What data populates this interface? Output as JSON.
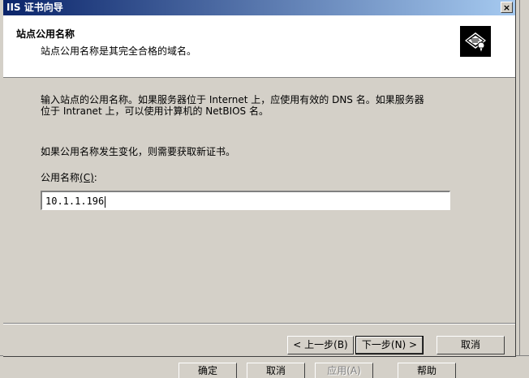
{
  "dialog": {
    "title": "IIS 证书向导",
    "close_label": "×",
    "header": {
      "title": "站点公用名称",
      "subtitle": "站点公用名称是其完全合格的域名。",
      "icon": "certificate-wizard-icon"
    },
    "description_line1": "输入站点的公用名称。如果服务器位于 Internet 上，应使用有效的 DNS 名。如果服务器",
    "description_line2": "位于 Intranet 上，可以使用计算机的 NetBIOS 名。",
    "change_note": "如果公用名称发生变化，则需要获取新证书。",
    "field_label": "公用名称",
    "field_accel": "(C)",
    "field_colon": ":",
    "common_name_value": "10.1.1.196",
    "buttons": {
      "back": "< 上一步(B)",
      "next": "下一步(N) >",
      "cancel": "取消"
    }
  },
  "parent_window": {
    "buttons": {
      "ok": "确定",
      "cancel": "取消",
      "apply": "应用(A)",
      "help": "帮助"
    }
  }
}
